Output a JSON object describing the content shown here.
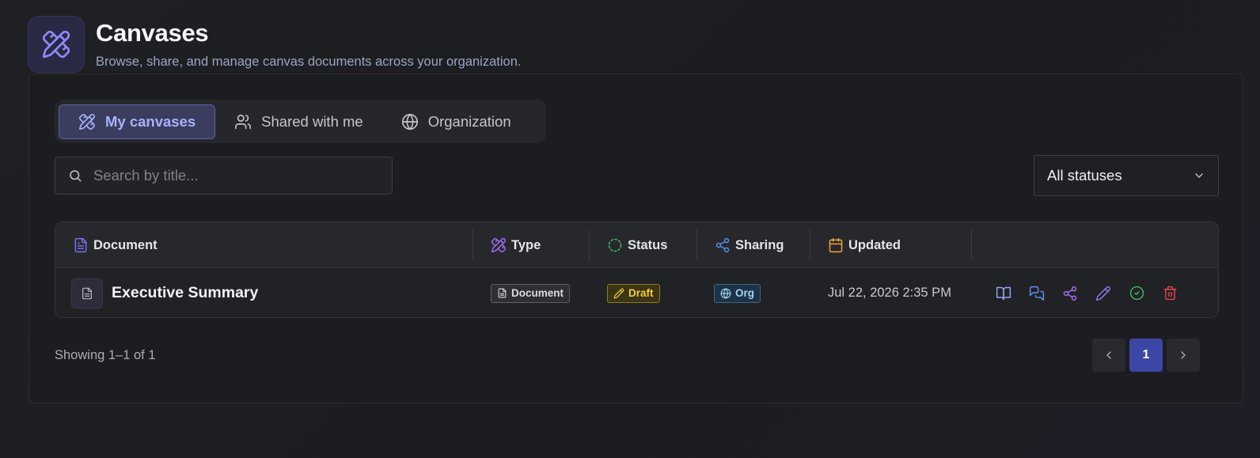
{
  "header": {
    "title": "Canvases",
    "subtitle": "Browse, share, and manage canvas documents across your organization.",
    "logo_icon": "pencil-ruler-icon"
  },
  "tabs": [
    {
      "label": "My canvases",
      "icon": "pencil-ruler-icon",
      "active": true
    },
    {
      "label": "Shared with me",
      "icon": "users-icon",
      "active": false
    },
    {
      "label": "Organization",
      "icon": "globe-icon",
      "active": false
    }
  ],
  "search": {
    "placeholder": "Search by title...",
    "value": ""
  },
  "status_filter": {
    "selected": "All statuses"
  },
  "table": {
    "columns": [
      {
        "label": "Document",
        "icon": "file-text-icon"
      },
      {
        "label": "Type",
        "icon": "pencil-ruler-icon"
      },
      {
        "label": "Status",
        "icon": "dashed-circle-icon"
      },
      {
        "label": "Sharing",
        "icon": "share-icon"
      },
      {
        "label": "Updated",
        "icon": "calendar-icon"
      }
    ],
    "rows": [
      {
        "title": "Executive Summary",
        "type": "Document",
        "status": "Draft",
        "sharing": "Org",
        "updated": "Jul 22, 2026 2:35 PM",
        "actions": [
          "book-open-icon",
          "comments-icon",
          "share-icon",
          "pencil-icon",
          "check-circle-icon",
          "trash-icon"
        ]
      }
    ]
  },
  "footer": {
    "showing": "Showing 1–1 of 1"
  },
  "pagination": {
    "current": "1"
  },
  "colors": {
    "accent": "#a8b2ff",
    "draft": "#f2cf3b",
    "org": "#a6d0f5",
    "danger": "#e5484d",
    "success": "#3fb96b",
    "page_active": "#3c46a6"
  }
}
